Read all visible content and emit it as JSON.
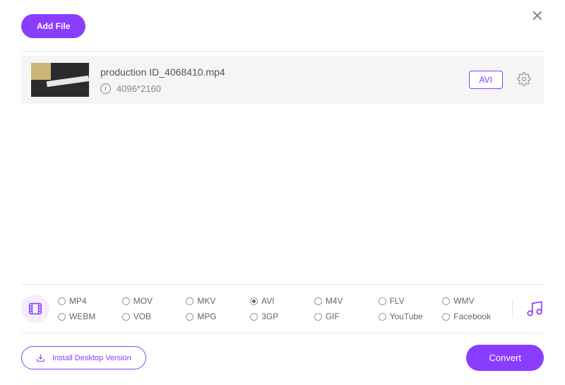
{
  "header": {
    "add_file_label": "Add File"
  },
  "file": {
    "name": "production ID_4068410.mp4",
    "resolution": "4096*2160",
    "target_format": "AVI"
  },
  "formats": {
    "row1": [
      {
        "label": "MP4",
        "selected": false
      },
      {
        "label": "MOV",
        "selected": false
      },
      {
        "label": "MKV",
        "selected": false
      },
      {
        "label": "AVI",
        "selected": true
      },
      {
        "label": "M4V",
        "selected": false
      },
      {
        "label": "FLV",
        "selected": false
      },
      {
        "label": "WMV",
        "selected": false
      }
    ],
    "row2": [
      {
        "label": "WEBM",
        "selected": false
      },
      {
        "label": "VOB",
        "selected": false
      },
      {
        "label": "MPG",
        "selected": false
      },
      {
        "label": "3GP",
        "selected": false
      },
      {
        "label": "GIF",
        "selected": false
      },
      {
        "label": "YouTube",
        "selected": false
      },
      {
        "label": "Facebook",
        "selected": false
      }
    ]
  },
  "footer": {
    "install_label": "Install Desktop Version",
    "convert_label": "Convert"
  }
}
